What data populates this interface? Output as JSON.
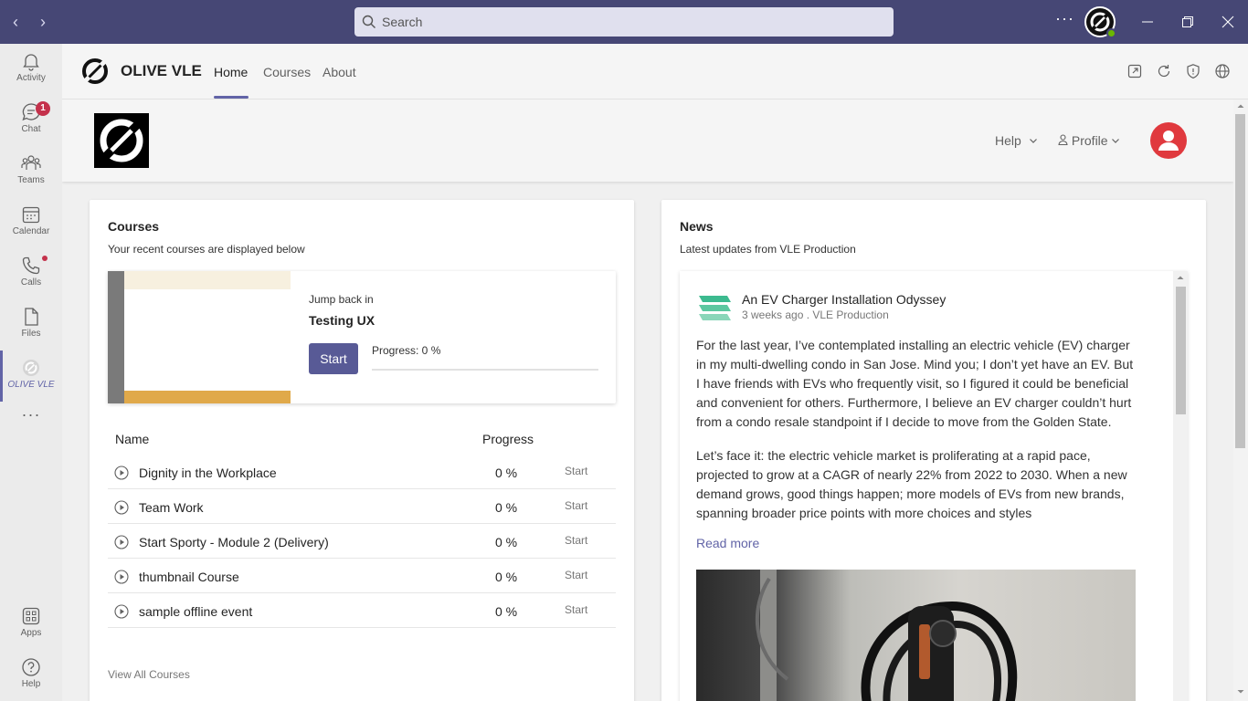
{
  "titlebar": {
    "search_placeholder": "Search",
    "more": "···"
  },
  "rail": {
    "items": [
      {
        "label": "Activity"
      },
      {
        "label": "Chat",
        "badge": "1"
      },
      {
        "label": "Teams"
      },
      {
        "label": "Calendar"
      },
      {
        "label": "Calls"
      },
      {
        "label": "Files"
      },
      {
        "label": "OLIVE VLE"
      },
      {
        "label": "···"
      },
      {
        "label": "Apps"
      },
      {
        "label": "Help"
      }
    ]
  },
  "app": {
    "title": "OLIVE VLE",
    "tabs": [
      "Home",
      "Courses",
      "About"
    ]
  },
  "banner": {
    "help": "Help",
    "profile": "Profile"
  },
  "courses": {
    "title": "Courses",
    "subtitle": "Your recent courses are displayed below",
    "jump_label": "Jump back in",
    "jump_course": "Testing UX",
    "start_label": "Start",
    "progress_label": "Progress: 0 %",
    "progress_value": 0,
    "col_name": "Name",
    "col_progress": "Progress",
    "rows": [
      {
        "name": "Dignity in the Workplace",
        "progress": "0 %",
        "action": "Start"
      },
      {
        "name": "Team Work",
        "progress": "0 %",
        "action": "Start"
      },
      {
        "name": "Start Sporty - Module 2 (Delivery)",
        "progress": "0 %",
        "action": "Start"
      },
      {
        "name": "thumbnail Course",
        "progress": "0 %",
        "action": "Start"
      },
      {
        "name": "sample offline event",
        "progress": "0 %",
        "action": "Start"
      }
    ],
    "view_all": "View All Courses"
  },
  "news": {
    "title": "News",
    "subtitle": "Latest updates from VLE Production",
    "article_title": "An EV Charger Installation Odyssey",
    "article_meta": "3 weeks ago . VLE Production",
    "para1": "For the last year, I’ve contemplated installing an electric vehicle (EV) charger in my multi-dwelling condo in San Jose. Mind you; I don’t yet have an EV. But I have friends with EVs who frequently visit, so I figured it could be beneficial and convenient for others. Furthermore, I believe an EV charger couldn’t hurt from a condo resale standpoint if I decide to move from the Golden State.",
    "para2": "Let’s face it: the electric vehicle market is proliferating at a rapid pace, projected to grow at a CAGR of nearly 22% from 2022 to 2030. When a new demand grows, good things happen; more models of EVs from new brands, spanning broader price points with more choices and styles",
    "read_more": "Read more"
  },
  "colors": {
    "titlebar": "#464775",
    "accent": "#6264a7",
    "button": "#585a96",
    "avatar": "#e0393e"
  }
}
